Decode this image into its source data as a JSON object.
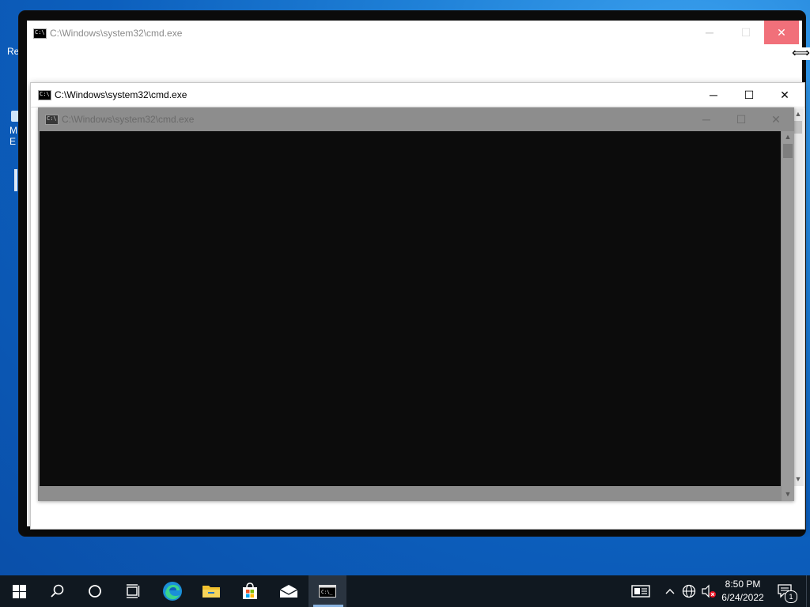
{
  "desktop": {
    "fragments": [
      "Re",
      "M",
      "E"
    ]
  },
  "back_window": {
    "title": "C:\\Windows\\system32\\cmd.exe",
    "close_color": "#f1707a"
  },
  "main_window": {
    "title": "C:\\Windows\\system32\\cmd.exe"
  },
  "ghost_window": {
    "title": "C:\\Windows\\system32\\cmd.exe"
  },
  "icons": {
    "minimize": "─",
    "maximize": "☐",
    "close": "✕",
    "resize_cursor": "⟺"
  },
  "taskbar": {
    "items": [
      {
        "name": "start-button",
        "icon": "windows-logo-icon"
      },
      {
        "name": "search-button",
        "icon": "search-icon"
      },
      {
        "name": "cortana-button",
        "icon": "circle-icon"
      },
      {
        "name": "task-view-button",
        "icon": "task-view-icon"
      },
      {
        "name": "edge-button",
        "icon": "edge-icon"
      },
      {
        "name": "file-explorer-button",
        "icon": "folder-icon"
      },
      {
        "name": "store-button",
        "icon": "store-icon"
      },
      {
        "name": "mail-button",
        "icon": "mail-icon"
      },
      {
        "name": "cmd-button",
        "icon": "cmd-icon",
        "active": true
      }
    ],
    "tray": {
      "time": "8:50 PM",
      "date": "6/24/2022",
      "notification_count": "1"
    }
  }
}
